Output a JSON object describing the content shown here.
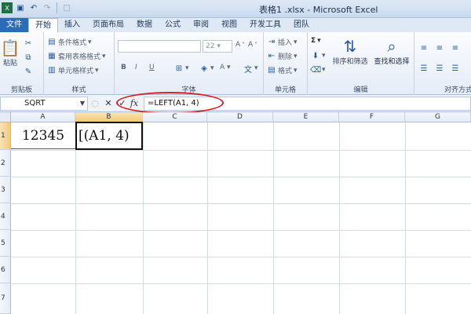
{
  "window": {
    "title": "表格1 .xlsx - Microsoft Excel"
  },
  "qat": {
    "icons": [
      "excel-icon",
      "save-icon",
      "undo-icon",
      "redo-icon",
      "new-icon"
    ]
  },
  "tabs": [
    {
      "label": "文件",
      "id": "file"
    },
    {
      "label": "开始",
      "id": "home",
      "active": true
    },
    {
      "label": "插入",
      "id": "insert"
    },
    {
      "label": "页面布局",
      "id": "page-layout"
    },
    {
      "label": "数据",
      "id": "data"
    },
    {
      "label": "公式",
      "id": "formulas"
    },
    {
      "label": "审阅",
      "id": "review"
    },
    {
      "label": "视图",
      "id": "view"
    },
    {
      "label": "开发工具",
      "id": "developer"
    },
    {
      "label": "团队",
      "id": "team"
    }
  ],
  "ribbon": {
    "clipboard": {
      "paste": "粘贴",
      "label": "剪贴板"
    },
    "styles": {
      "conditional": "条件格式",
      "table_format": "套用表格格式",
      "cell_styles": "单元格样式",
      "label": "样式"
    },
    "font": {
      "size": "22",
      "label": "字体",
      "bold": "B",
      "italic": "I",
      "underline": "U"
    },
    "cells": {
      "insert": "插入",
      "delete": "删除",
      "format": "格式",
      "label": "单元格"
    },
    "editing": {
      "sort_filter": "排序和筛选",
      "find_select": "查找和选择",
      "label": "编辑",
      "sigma": "Σ"
    },
    "alignment": {
      "label": "对齐方式"
    }
  },
  "formula_bar": {
    "name_box": "SQRT",
    "cancel": "✕",
    "enter": "✓",
    "fx": "fx",
    "formula": "=LEFT(A1, 4)"
  },
  "sheet": {
    "columns": [
      "A",
      "B",
      "C",
      "D",
      "E",
      "F",
      "G"
    ],
    "rows": [
      "1",
      "2",
      "3",
      "4",
      "5",
      "6",
      "7"
    ],
    "cells": {
      "A1": "12345",
      "B1": "[(A1, 4)"
    }
  },
  "colors": {
    "accent": "#2a6db6",
    "highlight": "#d61f1f"
  }
}
